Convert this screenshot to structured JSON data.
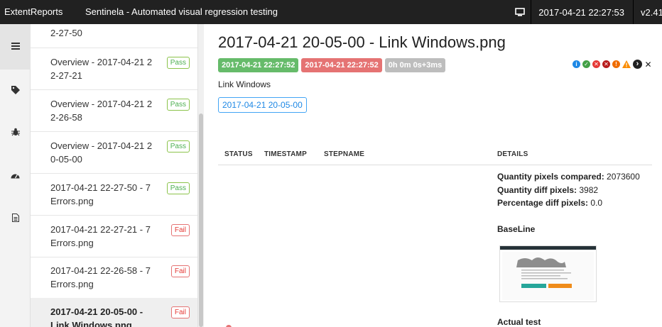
{
  "topbar": {
    "brand": "ExtentReports",
    "title": "Sentinela - Automated visual regression testing",
    "timestamp": "2017-04-21 22:27:53",
    "version": "v2.41.",
    "monitor_icon": "monitor-icon"
  },
  "rail": {
    "icons": [
      "list-icon",
      "tag-icon",
      "bug-icon",
      "dashboard-icon",
      "file-icon"
    ]
  },
  "tests": [
    {
      "name_lines": [
        "2-27-50",
        ""
      ],
      "status": ""
    },
    {
      "name_lines": [
        "Overview - 2017-04-21 2",
        "2-27-21"
      ],
      "status": "Pass"
    },
    {
      "name_lines": [
        "Overview - 2017-04-21 2",
        "2-26-58"
      ],
      "status": "Pass"
    },
    {
      "name_lines": [
        "Overview - 2017-04-21 2",
        "0-05-00"
      ],
      "status": "Pass"
    },
    {
      "name_lines": [
        "2017-04-21 22-27-50 - 7",
        "Errors.png"
      ],
      "status": "Pass"
    },
    {
      "name_lines": [
        "2017-04-21 22-27-21 - 7",
        "Errors.png"
      ],
      "status": "Fail"
    },
    {
      "name_lines": [
        "2017-04-21 22-26-58 - 7",
        "Errors.png"
      ],
      "status": "Fail"
    },
    {
      "name_lines": [
        "2017-04-21 20-05-00 -",
        "Link Windows.png"
      ],
      "status": "Fail"
    }
  ],
  "detail": {
    "title": "2017-04-21 20-05-00 - Link Windows.png",
    "start_time": "2017-04-21 22:27:52",
    "end_time": "2017-04-21 22:27:52",
    "duration": "0h 0m 0s+3ms",
    "status_filters": [
      {
        "icon": "info-icon",
        "color": "#1e88e5",
        "glyph": "i"
      },
      {
        "icon": "pass-icon",
        "color": "#43a047",
        "glyph": "✓"
      },
      {
        "icon": "fail-icon",
        "color": "#e53935",
        "glyph": "✕"
      },
      {
        "icon": "fatal-icon",
        "color": "#b71c1c",
        "glyph": "✕"
      },
      {
        "icon": "error-icon",
        "color": "#ef6c00",
        "glyph": "!"
      },
      {
        "icon": "warning-icon",
        "color": "#fb8c00",
        "glyph": "!"
      },
      {
        "icon": "skip-icon",
        "color": "#212121",
        "glyph": "›"
      },
      {
        "icon": "clear-icon",
        "color": "#212121",
        "glyph": "✕"
      }
    ],
    "description": "Link Windows",
    "category": "2017-04-21 20-05-00",
    "table_headers": {
      "status": "STATUS",
      "timestamp": "TIMESTAMP",
      "stepname": "STEPNAME",
      "details": "DETAILS"
    },
    "metrics": [
      {
        "label": "Quantity pixels compared:",
        "value": "2073600"
      },
      {
        "label": "Quantity diff pixels:",
        "value": "3982"
      },
      {
        "label": "Percentage diff pixels:",
        "value": "0.0"
      }
    ],
    "baseline_label": "BaseLine",
    "actual_label": "Actual test"
  },
  "colors": {
    "topbar": "#212121",
    "pass": "#66bb6a",
    "fail": "#e57373",
    "accent": "#1e88e5"
  }
}
